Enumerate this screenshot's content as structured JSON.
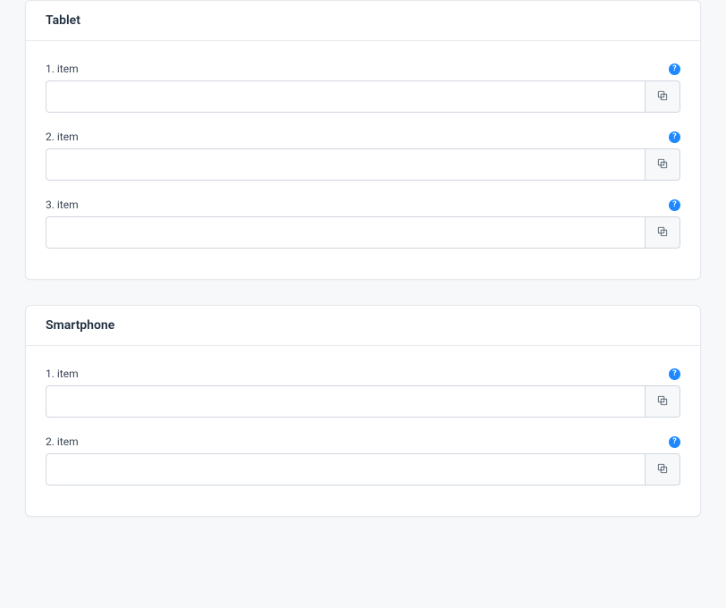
{
  "sections": [
    {
      "title": "Tablet",
      "items": [
        {
          "label": "1. item",
          "value": ""
        },
        {
          "label": "2. item",
          "value": ""
        },
        {
          "label": "3. item",
          "value": ""
        }
      ]
    },
    {
      "title": "Smartphone",
      "items": [
        {
          "label": "1. item",
          "value": ""
        },
        {
          "label": "2. item",
          "value": ""
        }
      ]
    }
  ],
  "helpGlyph": "?"
}
